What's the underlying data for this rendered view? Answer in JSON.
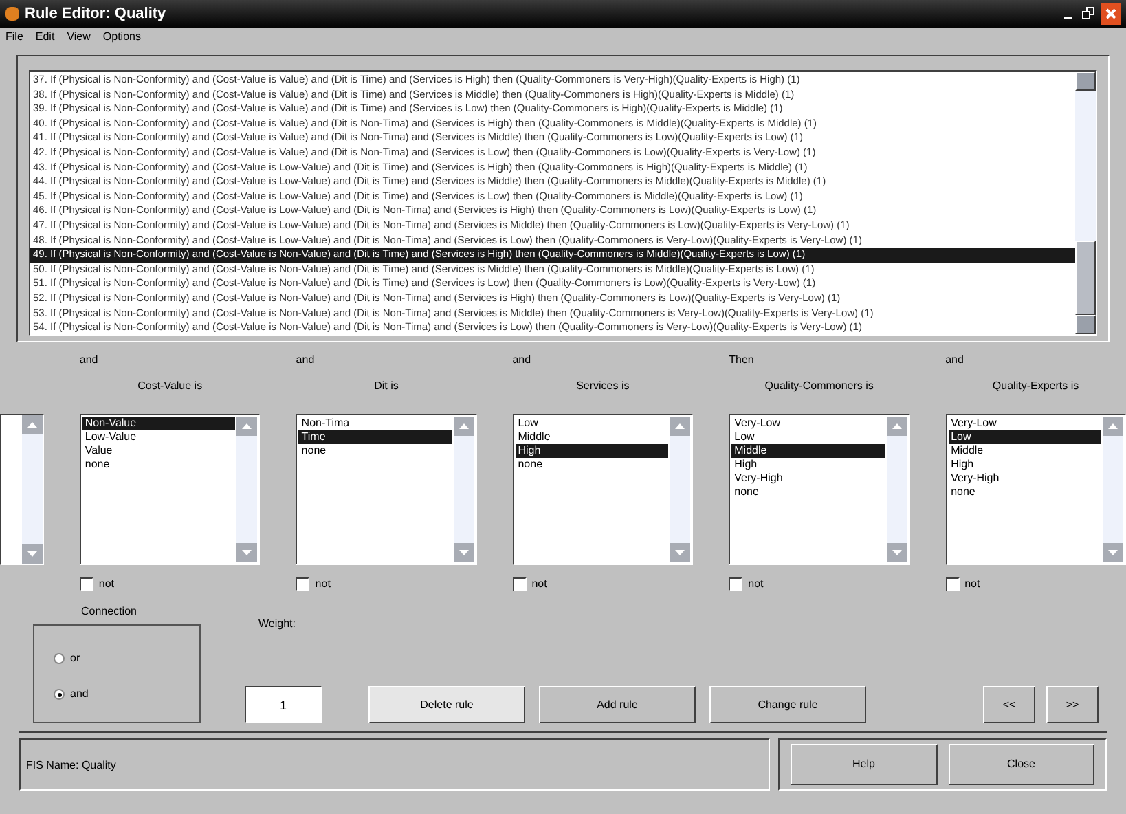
{
  "window": {
    "title": "Rule Editor: Quality"
  },
  "menu": [
    "File",
    "Edit",
    "View",
    "Options"
  ],
  "rules": [
    {
      "text": "37. If (Physical is Non-Conformity) and (Cost-Value is Value) and (Dit is Time) and (Services is High) then (Quality-Commoners is Very-High)(Quality-Experts is High) (1)",
      "selected": false
    },
    {
      "text": "38. If (Physical is Non-Conformity) and (Cost-Value is Value) and (Dit is Time) and (Services is Middle) then (Quality-Commoners is High)(Quality-Experts is Middle) (1)",
      "selected": false
    },
    {
      "text": "39. If (Physical is Non-Conformity) and (Cost-Value is Value) and (Dit is Time) and (Services is Low) then (Quality-Commoners is High)(Quality-Experts is Middle) (1)",
      "selected": false
    },
    {
      "text": "40. If (Physical is Non-Conformity) and (Cost-Value is Value) and (Dit is Non-Tima) and (Services is High) then (Quality-Commoners is Middle)(Quality-Experts is Middle) (1)",
      "selected": false
    },
    {
      "text": "41. If (Physical is Non-Conformity) and (Cost-Value is Value) and (Dit is Non-Tima) and (Services is Middle) then (Quality-Commoners is Low)(Quality-Experts is Low) (1)",
      "selected": false
    },
    {
      "text": "42. If (Physical is Non-Conformity) and (Cost-Value is Value) and (Dit is Non-Tima) and (Services is Low) then (Quality-Commoners is Low)(Quality-Experts is Very-Low) (1)",
      "selected": false
    },
    {
      "text": "43. If (Physical is Non-Conformity) and (Cost-Value is Low-Value) and (Dit is Time) and (Services is High) then (Quality-Commoners is High)(Quality-Experts is Middle) (1)",
      "selected": false
    },
    {
      "text": "44. If (Physical is Non-Conformity) and (Cost-Value is Low-Value) and (Dit is Time) and (Services is Middle) then (Quality-Commoners is Middle)(Quality-Experts is Middle) (1)",
      "selected": false
    },
    {
      "text": "45. If (Physical is Non-Conformity) and (Cost-Value is Low-Value) and (Dit is Time) and (Services is Low) then (Quality-Commoners is Middle)(Quality-Experts is Low) (1)",
      "selected": false
    },
    {
      "text": "46. If (Physical is Non-Conformity) and (Cost-Value is Low-Value) and (Dit is Non-Tima) and (Services is High) then (Quality-Commoners is Low)(Quality-Experts is Low) (1)",
      "selected": false
    },
    {
      "text": "47. If (Physical is Non-Conformity) and (Cost-Value is Low-Value) and (Dit is Non-Tima) and (Services is Middle) then (Quality-Commoners is Low)(Quality-Experts is Very-Low) (1)",
      "selected": false
    },
    {
      "text": "48. If (Physical is Non-Conformity) and (Cost-Value is Low-Value) and (Dit is Non-Tima) and (Services is Low) then (Quality-Commoners is Very-Low)(Quality-Experts is Very-Low) (1)",
      "selected": false
    },
    {
      "text": "49. If (Physical is Non-Conformity) and (Cost-Value is Non-Value) and (Dit is Time) and (Services is High) then (Quality-Commoners is Middle)(Quality-Experts is Low) (1)",
      "selected": true
    },
    {
      "text": "50. If (Physical is Non-Conformity) and (Cost-Value is Non-Value) and (Dit is Time) and (Services is Middle) then (Quality-Commoners is Middle)(Quality-Experts is Low) (1)",
      "selected": false
    },
    {
      "text": "51. If (Physical is Non-Conformity) and (Cost-Value is Non-Value) and (Dit is Time) and (Services is Low) then (Quality-Commoners is Low)(Quality-Experts is Very-Low) (1)",
      "selected": false
    },
    {
      "text": "52. If (Physical is Non-Conformity) and (Cost-Value is Non-Value) and (Dit is Non-Tima) and (Services is High) then (Quality-Commoners is Low)(Quality-Experts is Very-Low) (1)",
      "selected": false
    },
    {
      "text": "53. If (Physical is Non-Conformity) and (Cost-Value is Non-Value) and (Dit is Non-Tima) and (Services is Middle) then (Quality-Commoners is Very-Low)(Quality-Experts is Very-Low) (1)",
      "selected": false
    },
    {
      "text": "54. If (Physical is Non-Conformity) and (Cost-Value is Non-Value) and (Dit is Non-Tima) and (Services is Low) then (Quality-Commoners is Very-Low)(Quality-Experts is Very-Low) (1)",
      "selected": false
    }
  ],
  "columns": [
    {
      "connector": "and",
      "label": "Cost-Value is",
      "not": false,
      "items": [
        {
          "label": "Non-Value",
          "selected": true
        },
        {
          "label": "Low-Value",
          "selected": false
        },
        {
          "label": "Value",
          "selected": false
        },
        {
          "label": "none",
          "selected": false
        }
      ],
      "not_label": "not"
    },
    {
      "connector": "and",
      "label": "Dit is",
      "not": false,
      "items": [
        {
          "label": "Non-Tima",
          "selected": false
        },
        {
          "label": "Time",
          "selected": true
        },
        {
          "label": "none",
          "selected": false
        }
      ],
      "not_label": "not"
    },
    {
      "connector": "and",
      "label": "Services is",
      "not": false,
      "items": [
        {
          "label": "Low",
          "selected": false
        },
        {
          "label": "Middle",
          "selected": false
        },
        {
          "label": "High",
          "selected": true
        },
        {
          "label": "none",
          "selected": false
        }
      ],
      "not_label": "not"
    },
    {
      "connector": "Then",
      "label": "Quality-Commoners is",
      "not": false,
      "items": [
        {
          "label": "Very-Low",
          "selected": false
        },
        {
          "label": "Low",
          "selected": false
        },
        {
          "label": "Middle",
          "selected": true
        },
        {
          "label": "High",
          "selected": false
        },
        {
          "label": "Very-High",
          "selected": false
        },
        {
          "label": "none",
          "selected": false
        }
      ],
      "not_label": "not"
    },
    {
      "connector": "and",
      "label": "Quality-Experts is",
      "not": false,
      "items": [
        {
          "label": "Very-Low",
          "selected": false
        },
        {
          "label": "Low",
          "selected": true
        },
        {
          "label": "Middle",
          "selected": false
        },
        {
          "label": "High",
          "selected": false
        },
        {
          "label": "Very-High",
          "selected": false
        },
        {
          "label": "none",
          "selected": false
        }
      ],
      "not_label": "not"
    }
  ],
  "connection": {
    "title": "Connection",
    "options": [
      {
        "label": "or",
        "selected": false
      },
      {
        "label": "and",
        "selected": true
      }
    ]
  },
  "weight": {
    "label": "Weight:",
    "value": "1"
  },
  "buttons": [
    {
      "label": "Delete rule",
      "focused": true
    },
    {
      "label": "Add rule",
      "focused": false
    },
    {
      "label": "Change rule",
      "focused": false
    }
  ],
  "nav_buttons": [
    "<<",
    ">>"
  ],
  "status": "FIS Name: Quality",
  "footer_buttons": [
    "Help",
    "Close"
  ]
}
